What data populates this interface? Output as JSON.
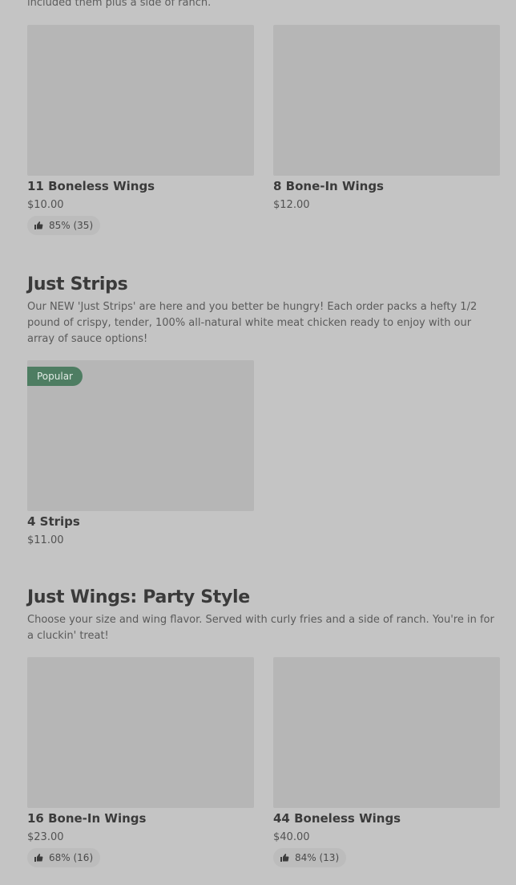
{
  "top_desc": "included them plus a side of ranch.",
  "section_wings": {
    "items": [
      {
        "name": "11 Boneless Wings",
        "price": "$10.00",
        "rating": "85% (35)"
      },
      {
        "name": "8 Bone-In Wings",
        "price": "$12.00"
      }
    ]
  },
  "section_strips": {
    "title": "Just Strips",
    "description": "Our NEW 'Just Strips' are here and you better be hungry! Each order packs a hefty 1/2 pound of crispy, tender, 100% all-natural white meat chicken ready to enjoy with our array of sauce options!",
    "items": [
      {
        "badge": "Popular",
        "name": "4 Strips",
        "price": "$11.00"
      }
    ]
  },
  "section_party": {
    "title": "Just Wings: Party Style",
    "description": "Choose your size and wing flavor. Served with curly fries and a side of ranch. You're in for a cluckin' treat!",
    "items": [
      {
        "name": "16 Bone-In Wings",
        "price": "$23.00",
        "rating": "68% (16)"
      },
      {
        "name": "44 Boneless Wings",
        "price": "$40.00",
        "rating": "84% (13)"
      }
    ]
  },
  "icons": {
    "rating": "thumbs-up-icon"
  },
  "colors": {
    "badge": "#4e7d62",
    "background": "#c4c4c4",
    "image_placeholder": "#b6b6b6"
  }
}
